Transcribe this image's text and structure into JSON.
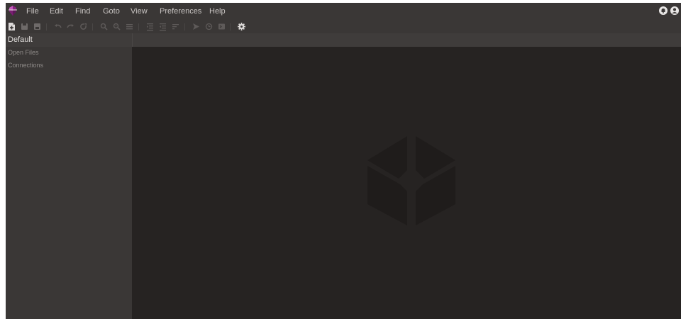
{
  "app": {
    "logo_icon": "purple-gem-logo-icon",
    "accent_color": "#a12d9a"
  },
  "menubar": {
    "items": [
      "File",
      "Edit",
      "Find",
      "Goto",
      "View",
      "Preferences",
      "Help"
    ],
    "right_icons": [
      "notifications-icon",
      "user-account-icon"
    ]
  },
  "toolbar": {
    "icons": [
      "new-file-icon",
      "save-icon",
      "save-all-icon",
      "undo-icon",
      "redo-icon",
      "refresh-icon",
      "find-icon",
      "find-replace-icon",
      "list-icon",
      "indent-icon",
      "outdent-icon",
      "format-icon",
      "run-icon",
      "history-icon",
      "terminal-icon",
      "settings-icon"
    ]
  },
  "tabs": [
    {
      "label": "Default"
    }
  ],
  "sidebar": {
    "items": [
      {
        "label": "Open Files"
      },
      {
        "label": "Connections"
      }
    ]
  },
  "main": {
    "watermark_icon": "cube-logo-icon"
  },
  "colors": {
    "window_bg": "#262322",
    "chrome_bg": "#3a3736",
    "menu_text": "#c9c5c3",
    "sidebar_text": "#8e8a88"
  }
}
